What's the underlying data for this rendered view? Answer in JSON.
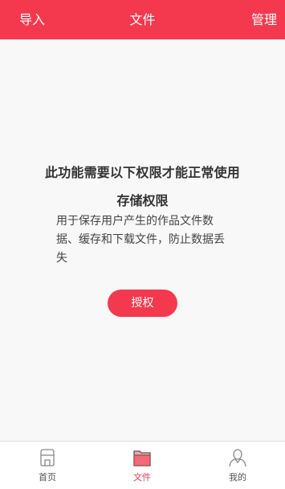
{
  "header": {
    "left_label": "导入",
    "title": "文件",
    "right_label": "管理"
  },
  "permission": {
    "heading": "此功能需要以下权限才能正常使用",
    "name": "存储权限",
    "description": "用于保存用户产生的作品文件数据、缓存和下载文件，防止数据丢失",
    "button_label": "授权"
  },
  "tabbar": {
    "items": [
      {
        "label": "首页",
        "icon": "home-icon",
        "active": false
      },
      {
        "label": "文件",
        "icon": "folder-icon",
        "active": true
      },
      {
        "label": "我的",
        "icon": "user-icon",
        "active": false
      }
    ]
  },
  "colors": {
    "accent": "#f4394e",
    "background": "#f8f8f8",
    "text": "#333333"
  }
}
